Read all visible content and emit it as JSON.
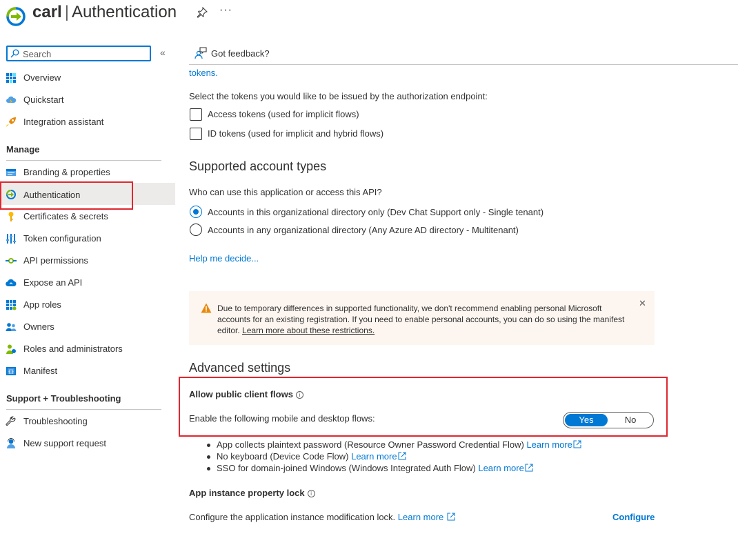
{
  "header": {
    "app_name": "carl",
    "separator": "|",
    "page_title": "Authentication",
    "more_label": "···"
  },
  "sidebar": {
    "search_placeholder": "Search",
    "collapse_glyph": "«",
    "items": [
      {
        "label": "Overview",
        "icon": "overview-grid-icon"
      },
      {
        "label": "Quickstart",
        "icon": "cloud-lightning-icon"
      },
      {
        "label": "Integration assistant",
        "icon": "rocket-icon"
      }
    ],
    "manage_heading": "Manage",
    "manage_items": [
      {
        "label": "Branding & properties",
        "icon": "branding-icon"
      },
      {
        "label": "Authentication",
        "icon": "authentication-icon"
      },
      {
        "label": "Certificates & secrets",
        "icon": "key-icon"
      },
      {
        "label": "Token configuration",
        "icon": "token-bars-icon"
      },
      {
        "label": "API permissions",
        "icon": "api-permissions-icon"
      },
      {
        "label": "Expose an API",
        "icon": "cloud-icon"
      },
      {
        "label": "App roles",
        "icon": "app-roles-grid-icon"
      },
      {
        "label": "Owners",
        "icon": "owners-icon"
      },
      {
        "label": "Roles and administrators",
        "icon": "roles-admins-icon"
      },
      {
        "label": "Manifest",
        "icon": "manifest-icon"
      }
    ],
    "support_heading": "Support + Troubleshooting",
    "support_items": [
      {
        "label": "Troubleshooting",
        "icon": "wrench-icon"
      },
      {
        "label": "New support request",
        "icon": "support-person-icon"
      }
    ]
  },
  "toolbar": {
    "feedback_label": "Got feedback?"
  },
  "main": {
    "tokens_link": "tokens.",
    "tokens_prompt": "Select the tokens you would like to be issued by the authorization endpoint:",
    "access_tokens_label": "Access tokens (used for implicit flows)",
    "id_tokens_label": "ID tokens (used for implicit and hybrid flows)",
    "supported_heading": "Supported account types",
    "who_prompt": "Who can use this application or access this API?",
    "single_tenant_label": "Accounts in this organizational directory only (Dev Chat Support only - Single tenant)",
    "multi_tenant_label": "Accounts in any organizational directory (Any Azure AD directory - Multitenant)",
    "help_link": "Help me decide...",
    "warning_text": "Due to temporary differences in supported functionality, we don't recommend enabling personal Microsoft accounts for an existing registration. If you need to enable personal accounts, you can do so using the manifest editor.",
    "warning_link": "Learn more about these restrictions.",
    "close_glyph": "✕",
    "advanced_heading": "Advanced settings",
    "public_flows_label": "Allow public client flows",
    "enable_flows_text": "Enable the following mobile and desktop flows:",
    "toggle_yes": "Yes",
    "toggle_no": "No",
    "toggle_selected": "Yes",
    "flows": [
      {
        "text": "App collects plaintext password (Resource Owner Password Credential Flow)",
        "link": "Learn more"
      },
      {
        "text": "No keyboard (Device Code Flow)",
        "link": "Learn more"
      },
      {
        "text": "SSO for domain-joined Windows (Windows Integrated Auth Flow)",
        "link": "Learn more"
      }
    ],
    "instance_lock_label": "App instance property lock",
    "instance_lock_text": "Configure the application instance modification lock.",
    "instance_lock_link": "Learn more",
    "configure_label": "Configure"
  },
  "colors": {
    "accent": "#0078d4",
    "highlight_outline": "#e0262f",
    "warning_bg": "#fdf6f0",
    "warning_icon": "#e8890c",
    "active_nav_bg": "#edebe9"
  }
}
